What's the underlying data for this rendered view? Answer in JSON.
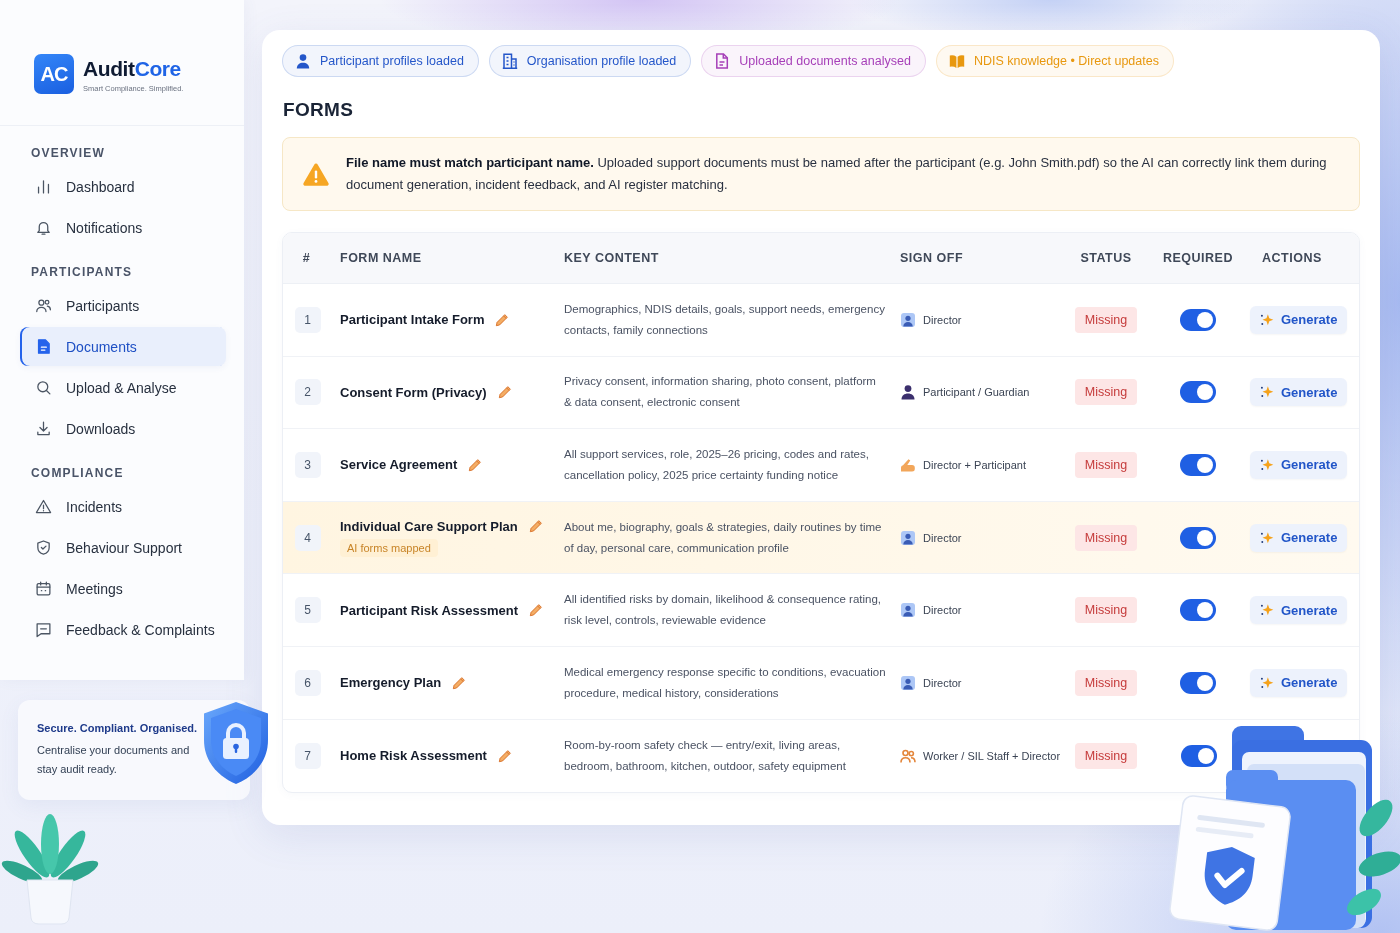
{
  "brand": {
    "mark": "AC",
    "name_lead": "Audit",
    "name_accent": "Core",
    "tagline": "Smart Compliance. Simplified."
  },
  "sidebar": {
    "sections": [
      {
        "title": "OVERVIEW",
        "items": [
          {
            "label": "Dashboard",
            "selected": false
          },
          {
            "label": "Notifications",
            "selected": false
          }
        ]
      },
      {
        "title": "PARTICIPANTS",
        "items": [
          {
            "label": "Participants",
            "selected": false
          },
          {
            "label": "Documents",
            "selected": true
          },
          {
            "label": "Upload & Analyse",
            "selected": false
          },
          {
            "label": "Downloads",
            "selected": false
          }
        ]
      },
      {
        "title": "COMPLIANCE",
        "items": [
          {
            "label": "Incidents",
            "selected": false
          },
          {
            "label": "Behaviour Support",
            "selected": false
          },
          {
            "label": "Meetings",
            "selected": false
          },
          {
            "label": "Feedback & Complaints",
            "selected": false
          }
        ]
      }
    ]
  },
  "promo": {
    "title": "Secure. Compliant. Organised.",
    "text": "Centralise your documents and stay audit ready."
  },
  "status_chips": [
    {
      "label": "Participant profiles loaded",
      "color": "#2456c9"
    },
    {
      "label": "Organisation profile loaded",
      "color": "#2456c9"
    },
    {
      "label": "Uploaded documents analysed",
      "color": "#a63fb8"
    },
    {
      "label": "NDIS knowledge • Direct updates",
      "color": "#e8980f"
    }
  ],
  "page_title": "FORMS",
  "notice": {
    "text": "**File name must match participant name.** Uploaded support documents must be named after the participant (e.g. John Smith.pdf) so the AI can correctly link them during document generation, incident feedback, and AI register matching."
  },
  "table": {
    "columns": [
      "#",
      "FORM NAME",
      "KEY CONTENT",
      "SIGN OFF",
      "STATUS",
      "REQUIRED",
      "ACTIONS"
    ],
    "rows": [
      {
        "number": "1",
        "name": "Participant Intake Form",
        "key_content": "Demographics, NDIS details, goals, support needs, emergency contacts, family connections",
        "sign_off": {
          "kind": "badge",
          "text": "Director"
        },
        "status": "Missing",
        "required": true,
        "action": "Generate",
        "selected": false
      },
      {
        "number": "2",
        "name": "Consent Form (Privacy)",
        "key_content": "Privacy consent, information sharing, photo consent, platform & data consent, electronic consent",
        "sign_off": {
          "kind": "person",
          "text": "Participant / Guardian"
        },
        "status": "Missing",
        "required": true,
        "action": "Generate",
        "selected": false
      },
      {
        "number": "3",
        "name": "Service Agreement",
        "key_content": "All support services, role, 2025–26 pricing, codes and rates, cancellation policy, 2025 price certainty funding notice",
        "sign_off": {
          "kind": "hand",
          "text": "Director + Participant"
        },
        "status": "Missing",
        "required": true,
        "action": "Generate",
        "selected": false
      },
      {
        "number": "4",
        "name": "Individual Care Support Plan",
        "tag": "AI forms mapped",
        "key_content": "About me, biography, goals & strategies, daily routines by time of day, personal care, communication profile",
        "sign_off": {
          "kind": "badge",
          "text": "Director"
        },
        "status": "Missing",
        "required": true,
        "action": "Generate",
        "selected": true
      },
      {
        "number": "5",
        "name": "Participant Risk Assessment",
        "key_content": "All identified risks by domain, likelihood & consequence rating, risk level, controls, reviewable evidence",
        "sign_off": {
          "kind": "badge",
          "text": "Director"
        },
        "status": "Missing",
        "required": true,
        "action": "Generate",
        "selected": false
      },
      {
        "number": "6",
        "name": "Emergency Plan",
        "key_content": "Medical emergency response specific to conditions, evacuation procedure, medical history, considerations",
        "sign_off": {
          "kind": "badge",
          "text": "Director"
        },
        "status": "Missing",
        "required": true,
        "action": "Generate",
        "selected": false
      },
      {
        "number": "7",
        "name": "Home Risk Assessment",
        "key_content": "Room-by-room safety check — entry/exit, living areas, bedroom, bathroom, kitchen, outdoor, safety equipment",
        "sign_off": {
          "kind": "group",
          "text": "Worker / SIL Staff + Director"
        },
        "status": "Missing",
        "required": true,
        "selected": false
      }
    ]
  }
}
